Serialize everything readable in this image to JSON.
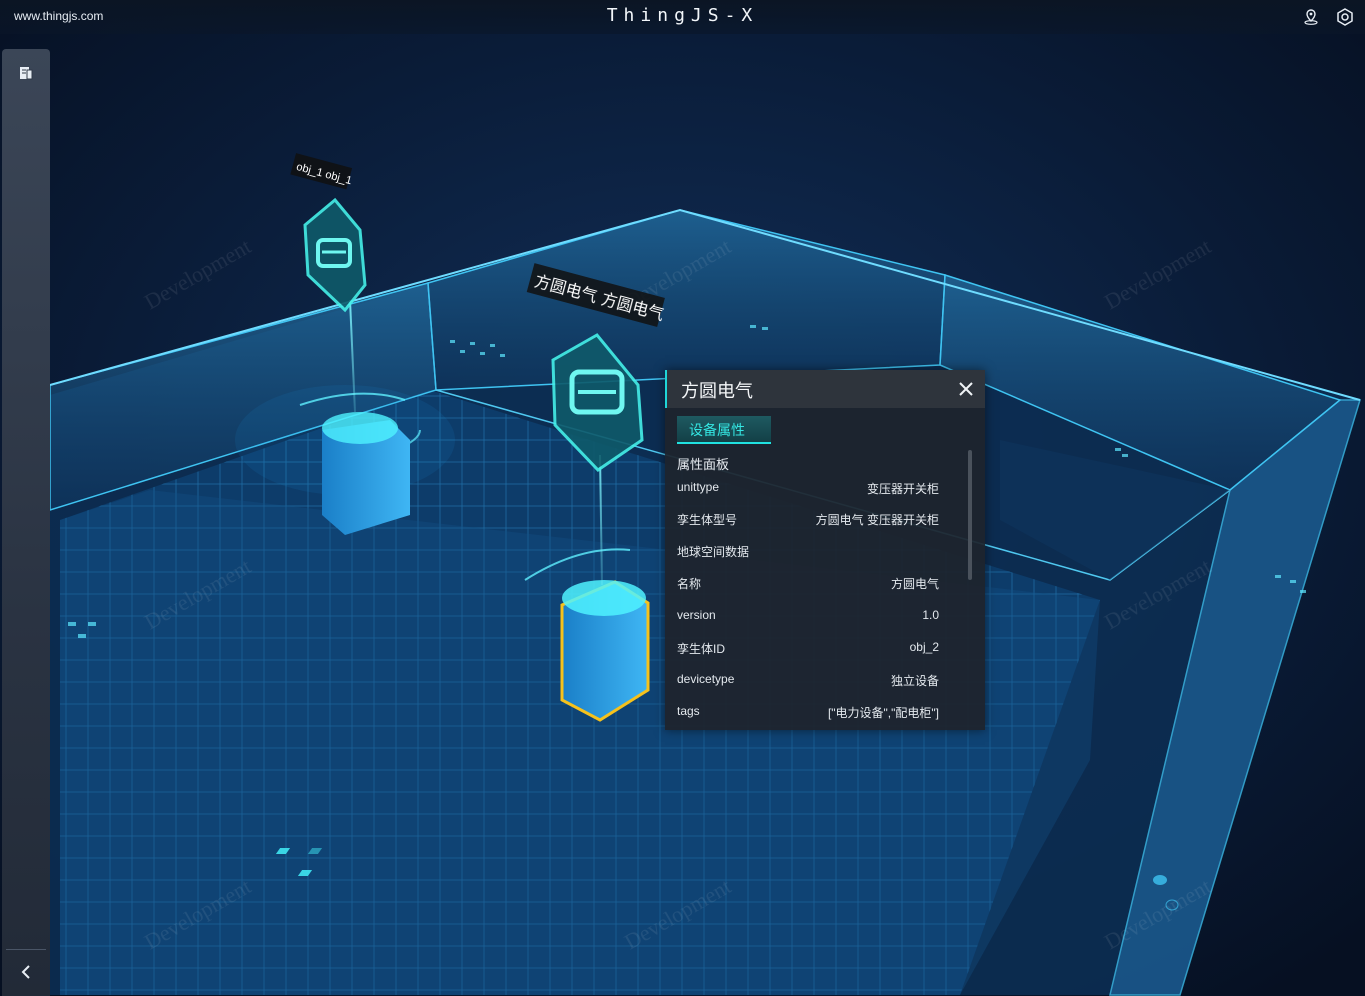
{
  "topbar": {
    "site": "www.thingjs.com",
    "title": "ThingJS-X",
    "icons": [
      "location-pin-icon",
      "settings-hex-icon"
    ]
  },
  "sidebar": {
    "icons": [
      "document-icon",
      "chevron-left-icon"
    ]
  },
  "scene": {
    "labels": [
      {
        "text": "obj_1  obj_1"
      },
      {
        "text": "方圆电气  方圆电气"
      }
    ],
    "watermark": "Development",
    "marker_icon": "car-icon",
    "colors": {
      "wall": "#3fc4f2",
      "grid": "#1b6fa8",
      "floor": "#0d3a66",
      "highlight": "#f6c21c",
      "accent": "#1fd6d8"
    }
  },
  "panel": {
    "title": "方圆电气",
    "tab": "设备属性",
    "group_title": "属性面板",
    "rows": [
      {
        "key": "unittype",
        "value": "变压器开关柜"
      },
      {
        "key": "孪生体型号",
        "value": "方圆电气 变压器开关柜"
      },
      {
        "key": "地球空间数据",
        "value": ""
      },
      {
        "key": "名称",
        "value": "方圆电气"
      },
      {
        "key": "version",
        "value": "1.0"
      },
      {
        "key": "孪生体ID",
        "value": "obj_2"
      },
      {
        "key": "devicetype",
        "value": "独立设备"
      },
      {
        "key": "tags",
        "value": "[\"电力设备\",\"配电柜\"]"
      }
    ]
  }
}
